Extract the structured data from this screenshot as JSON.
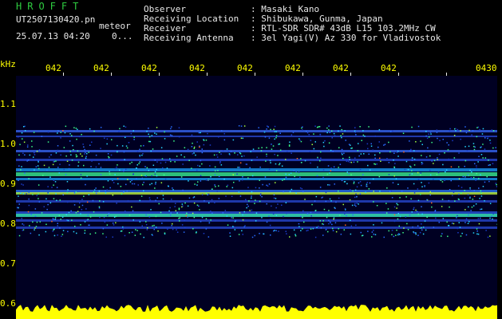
{
  "header": {
    "logo": "HROFFT",
    "filename": "UT2507130420.pn",
    "mode": "meteor",
    "datetime": "25.07.13 04:20",
    "extra": "0...",
    "info_labels": [
      "Observer",
      "Receiving Location",
      "Receiver",
      "Receiving Antenna"
    ],
    "info_values": [
      ": Masaki Kano",
      ": Shibukawa, Gunma, Japan",
      ": RTL-SDR SDR# 43dB L15 103.2MHz CW",
      ": 3el Yagi(V) Az 330 for Vladivostok"
    ]
  },
  "axes": {
    "y_unit": "kHz",
    "y_ticks": [
      "1.1",
      "1.0",
      "0.9",
      "0.8",
      "0.7",
      "0.6"
    ],
    "x_ticks": [
      "042",
      "042",
      "042",
      "042",
      "042",
      "042",
      "042",
      "042",
      "0430"
    ]
  },
  "colors": {
    "label": "#ffff00",
    "logo": "#2ecc40",
    "text": "#e8e8e8",
    "background": "#000000"
  }
}
